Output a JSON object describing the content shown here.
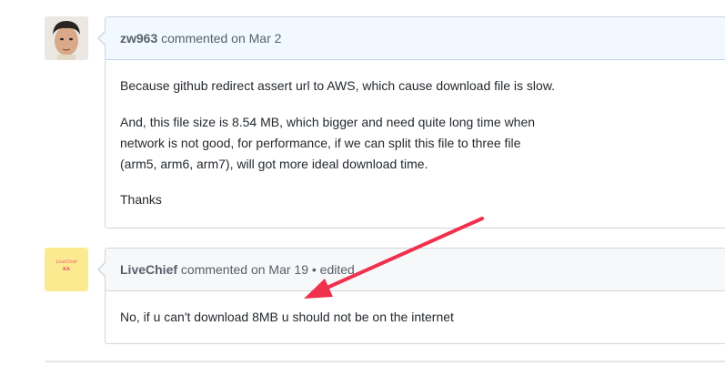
{
  "comments": [
    {
      "author": "zw963",
      "action": "commented on",
      "date": "Mar 2",
      "edited": "",
      "paragraphs": [
        "Because github redirect assert url to AWS, which cause download file is slow.",
        "And, this file size is 8.54 MB, which bigger and need quite long time when",
        "network is not good, for performance, if we can split this file to three file",
        "(arm5, arm6, arm7), will got more ideal download time.",
        "Thanks"
      ]
    },
    {
      "author": "LiveChief",
      "action": "commented on",
      "date": "Mar 19",
      "edited": "• edited",
      "paragraphs": [
        "No, if u can't download 8MB u should not be on the internet"
      ],
      "avatar_text": [
        "LiveChief",
        "KA"
      ]
    }
  ],
  "colors": {
    "arrow": "#f0314e",
    "header_blue": "#f1f8ff",
    "header_gray": "#f6f8fa",
    "border": "#d1d5da"
  }
}
